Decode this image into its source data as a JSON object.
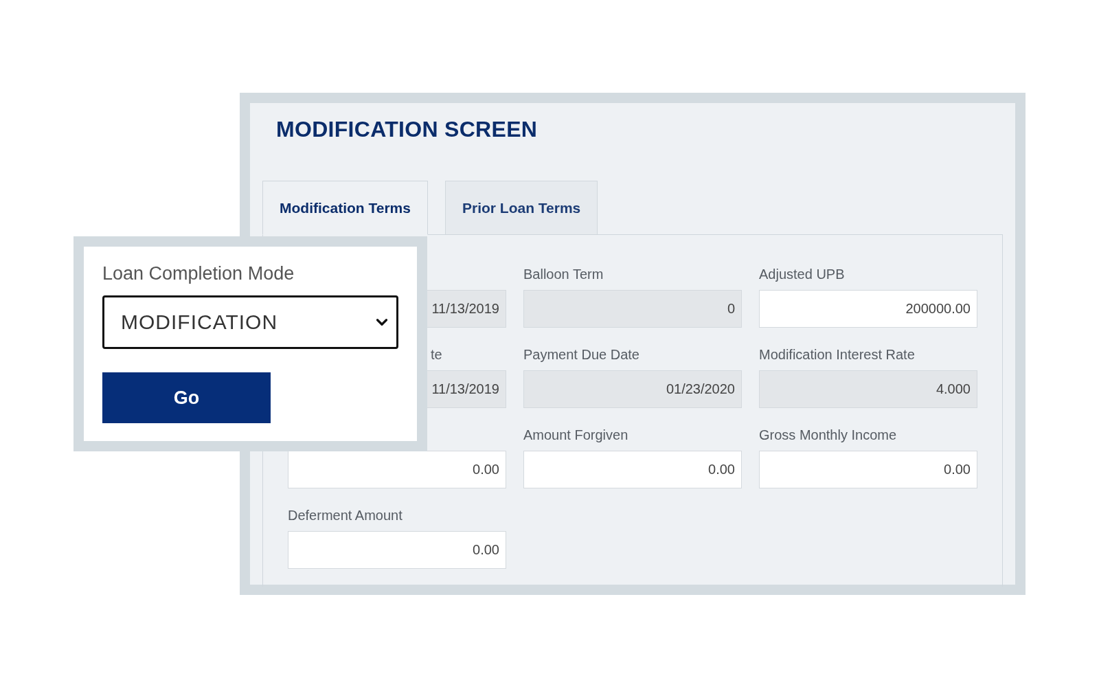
{
  "screen": {
    "title": "MODIFICATION SCREEN"
  },
  "tabs": [
    {
      "label": "Modification Terms",
      "selected": true
    },
    {
      "label": "Prior Loan Terms",
      "selected": false
    }
  ],
  "fields": [
    {
      "value": "11/13/2019",
      "disabled": true
    },
    {
      "label": "Balloon Term",
      "value": "0",
      "disabled": true
    },
    {
      "label": "Adjusted UPB",
      "value": "200000.00",
      "disabled": false
    },
    {
      "label": "te",
      "label_clipped": true,
      "value": "11/13/2019",
      "disabled": true
    },
    {
      "label": "Payment Due Date",
      "value": "01/23/2020",
      "disabled": true
    },
    {
      "label": "Modification Interest Rate",
      "value": "4.000",
      "disabled": true
    },
    {
      "value": "0.00",
      "disabled": false
    },
    {
      "label": "Amount Forgiven",
      "value": "0.00",
      "disabled": false
    },
    {
      "label": "Gross Monthly Income",
      "value": "0.00",
      "disabled": false
    },
    {
      "label": "Deferment Amount",
      "value": "0.00",
      "disabled": false
    }
  ],
  "popup": {
    "label": "Loan Completion Mode",
    "select_value": "MODIFICATION",
    "button": "Go"
  }
}
